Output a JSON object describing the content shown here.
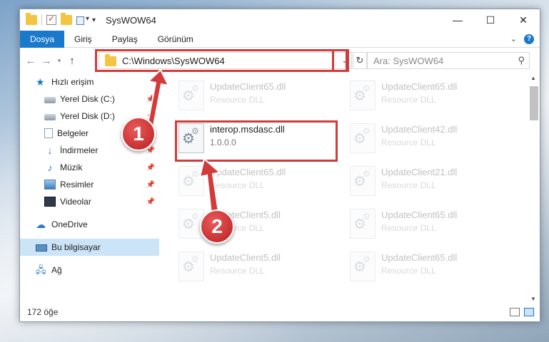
{
  "window": {
    "title": "SysWOW64"
  },
  "ribbon": {
    "tabs": [
      "Dosya",
      "Giriş",
      "Paylaş",
      "Görünüm"
    ]
  },
  "address": {
    "path": "C:\\Windows\\SysWOW64",
    "search_placeholder": "Ara: SysWOW64"
  },
  "sidebar": {
    "quick_access": "Hızlı erişim",
    "items": [
      {
        "label": "Yerel Disk (C:)",
        "icon": "drive-icon"
      },
      {
        "label": "Yerel Disk (D:)",
        "icon": "drive-icon"
      },
      {
        "label": "Belgeler",
        "icon": "documents-icon"
      },
      {
        "label": "İndirmeler",
        "icon": "downloads-icon"
      },
      {
        "label": "Müzik",
        "icon": "music-icon"
      },
      {
        "label": "Resimler",
        "icon": "pictures-icon"
      },
      {
        "label": "Videolar",
        "icon": "videos-icon"
      }
    ],
    "onedrive": "OneDrive",
    "this_pc": "Bu bilgisayar",
    "network": "Ağ"
  },
  "files": [
    {
      "name": "UpdateClient65.dll",
      "desc": "Resource DLL"
    },
    {
      "name": "UpdateClient65.dll",
      "desc": "Resource DLL"
    },
    {
      "name": "interop.msdasc.dll",
      "desc": "1.0.0.0"
    },
    {
      "name": "UpdateClient42.dll",
      "desc": "Resource DLL"
    },
    {
      "name": "UpdateClient65.dll",
      "desc": "Resource DLL"
    },
    {
      "name": "UpdateClient21.dll",
      "desc": "Resource DLL"
    },
    {
      "name": "UpdateClient5.dll",
      "desc": "Resource DLL"
    },
    {
      "name": "UpdateClient65.dll",
      "desc": "Resource DLL"
    },
    {
      "name": "UpdateClient5.dll",
      "desc": "Resource DLL"
    },
    {
      "name": "UpdateClient65.dll",
      "desc": "Resource DLL"
    }
  ],
  "status": {
    "count": "172 öğe"
  },
  "annotations": {
    "step1": "1",
    "step2": "2",
    "color": "#d33b3b"
  }
}
